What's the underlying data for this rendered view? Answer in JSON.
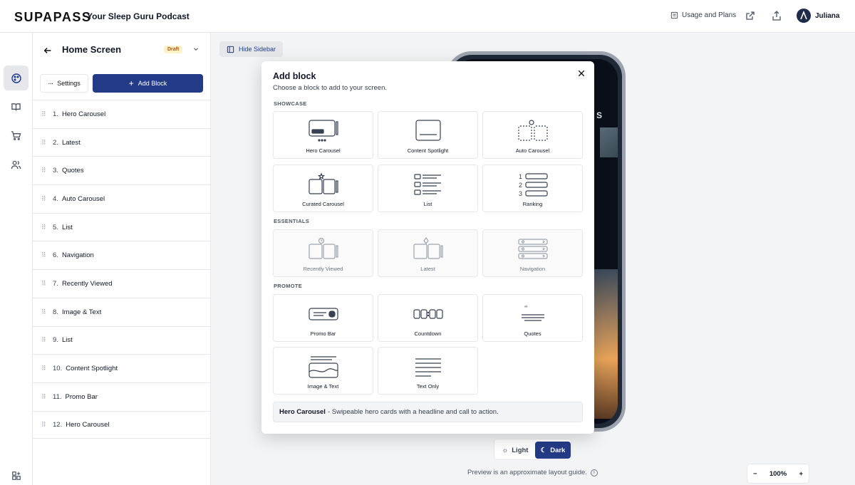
{
  "app": {
    "logo": "SUPAPASS",
    "title": "Your Sleep Guru Podcast"
  },
  "header": {
    "usage_label": "Usage and Plans",
    "user_name": "Juliana"
  },
  "panel": {
    "title": "Home Screen",
    "status": "Draft",
    "settings_label": "Settings",
    "add_block_label": "Add Block",
    "blocks": [
      {
        "num": "1.",
        "label": "Hero Carousel"
      },
      {
        "num": "2.",
        "label": "Latest"
      },
      {
        "num": "3.",
        "label": "Quotes"
      },
      {
        "num": "4.",
        "label": "Auto Carousel"
      },
      {
        "num": "5.",
        "label": "List"
      },
      {
        "num": "6.",
        "label": "Navigation"
      },
      {
        "num": "7.",
        "label": "Recently Viewed"
      },
      {
        "num": "8.",
        "label": "Image & Text"
      },
      {
        "num": "9.",
        "label": "List"
      },
      {
        "num": "10.",
        "label": "Content Spotlight"
      },
      {
        "num": "11.",
        "label": "Promo Bar"
      },
      {
        "num": "12.",
        "label": "Hero Carousel"
      }
    ]
  },
  "canvas": {
    "hide_sidebar_label": "Hide Sidebar",
    "phone_text": "S",
    "theme": {
      "light_label": "Light",
      "dark_label": "Dark"
    },
    "preview_note": "Preview is an approximate layout guide.",
    "zoom": "100%"
  },
  "modal": {
    "title": "Add block",
    "subtitle": "Choose a block to add to your screen.",
    "sections": {
      "showcase": "SHOWCASE",
      "essentials": "ESSENTIALS",
      "promote": "PROMOTE"
    },
    "cards": {
      "hero_carousel": "Hero Carousel",
      "content_spotlight": "Content Spotlight",
      "auto_carousel": "Auto Carousel",
      "curated_carousel": "Curated Carousel",
      "list": "List",
      "ranking": "Ranking",
      "recently_viewed": "Recently Viewed",
      "latest": "Latest",
      "navigation": "Navigation",
      "promo_bar": "Promo Bar",
      "countdown": "Countdown",
      "quotes": "Quotes",
      "image_text": "Image & Text",
      "text_only": "Text Only"
    },
    "description": {
      "name": "Hero Carousel",
      "text": "- Swipeable hero cards with a headline and call to action."
    }
  },
  "colors": {
    "accent": "#233b87",
    "draft": "#b45309",
    "draft_bg": "#fef3c7"
  }
}
